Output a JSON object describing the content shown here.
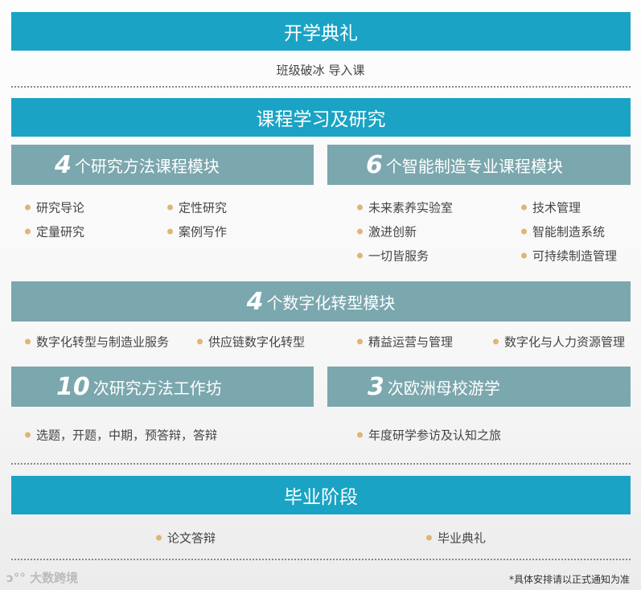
{
  "opening": {
    "title": "开学典礼",
    "item": "班级破冰 导入课"
  },
  "study": {
    "title": "课程学习及研究",
    "research": {
      "num": "4",
      "title": "个研究方法课程模块",
      "items": [
        "研究导论",
        "定性研究",
        "定量研究",
        "案例写作"
      ]
    },
    "smart": {
      "num": "6",
      "title": "个智能制造专业课程模块",
      "items": [
        "未来素养实验室",
        "技术管理",
        "激进创新",
        "智能制造系统",
        "一切皆服务",
        "可持续制造管理"
      ]
    },
    "digital": {
      "num": "4",
      "title": " 个数字化转型模块",
      "items": [
        "数字化转型与制造业服务",
        "供应链数字化转型",
        "精益运营与管理",
        "数字化与人力资源管理"
      ]
    },
    "workshop": {
      "num": "10",
      "title": "次研究方法工作坊",
      "items": [
        "选题，开题，中期，预答辩，答辩"
      ]
    },
    "europe": {
      "num": "3",
      "title": "次欧洲母校游学",
      "items": [
        "年度研学参访及认知之旅"
      ]
    }
  },
  "graduation": {
    "title": "毕业阶段",
    "items": [
      "论文答辩",
      "毕业典礼"
    ]
  },
  "footer": {
    "logo": "大数跨境",
    "note": "*具体安排请以正式通知为准"
  }
}
